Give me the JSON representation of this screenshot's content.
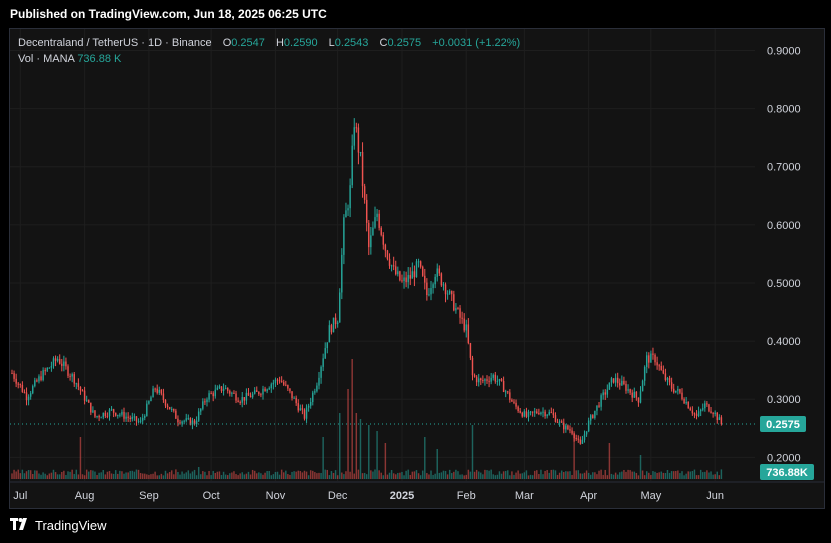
{
  "header": {
    "published": "Published on TradingView.com, Jun 18, 2025 06:25 UTC"
  },
  "legend": {
    "symbol": "Decentraland / TetherUS · 1D · Binance",
    "o_label": "O",
    "o_value": "0.2547",
    "h_label": "H",
    "h_value": "0.2590",
    "l_label": "L",
    "l_value": "0.2543",
    "c_label": "C",
    "c_value": "0.2575",
    "change": "+0.0031 (+1.22%)",
    "vol_label": "Vol · MANA",
    "vol_value": "736.88 K"
  },
  "footer": {
    "brand": "TradingView"
  },
  "colors": {
    "up": "#26a69a",
    "down": "#ef5350",
    "price_badge": "#26a69a",
    "background": "#131313"
  },
  "chart_data": {
    "type": "candlestick",
    "y_ticks": [
      "0.9000",
      "0.8000",
      "0.7000",
      "0.6000",
      "0.5000",
      "0.4000",
      "0.3000",
      "0.2000"
    ],
    "ylim": [
      0.18,
      0.93
    ],
    "x_labels": [
      "Jul",
      "Aug",
      "Sep",
      "Oct",
      "Nov",
      "Dec",
      "2025",
      "Feb",
      "Mar",
      "Apr",
      "May",
      "Jun"
    ],
    "last_price": "0.2575",
    "last_volume": "736.88K",
    "series": [
      {
        "name": "price",
        "anchors": [
          {
            "d": 0,
            "v": 0.345
          },
          {
            "d": 7,
            "v": 0.305
          },
          {
            "d": 14,
            "v": 0.34
          },
          {
            "d": 22,
            "v": 0.37
          },
          {
            "d": 30,
            "v": 0.335
          },
          {
            "d": 40,
            "v": 0.27
          },
          {
            "d": 48,
            "v": 0.28
          },
          {
            "d": 55,
            "v": 0.27
          },
          {
            "d": 62,
            "v": 0.26
          },
          {
            "d": 69,
            "v": 0.32
          },
          {
            "d": 80,
            "v": 0.265
          },
          {
            "d": 88,
            "v": 0.26
          },
          {
            "d": 94,
            "v": 0.305
          },
          {
            "d": 102,
            "v": 0.32
          },
          {
            "d": 110,
            "v": 0.3
          },
          {
            "d": 118,
            "v": 0.31
          },
          {
            "d": 124,
            "v": 0.325
          },
          {
            "d": 129,
            "v": 0.335
          },
          {
            "d": 135,
            "v": 0.305
          },
          {
            "d": 141,
            "v": 0.27
          },
          {
            "d": 147,
            "v": 0.33
          },
          {
            "d": 153,
            "v": 0.42
          },
          {
            "d": 157,
            "v": 0.44
          },
          {
            "d": 160,
            "v": 0.6
          },
          {
            "d": 163,
            "v": 0.66
          },
          {
            "d": 165,
            "v": 0.78
          },
          {
            "d": 168,
            "v": 0.71
          },
          {
            "d": 172,
            "v": 0.56
          },
          {
            "d": 176,
            "v": 0.62
          },
          {
            "d": 180,
            "v": 0.56
          },
          {
            "d": 184,
            "v": 0.52
          },
          {
            "d": 188,
            "v": 0.5
          },
          {
            "d": 192,
            "v": 0.51
          },
          {
            "d": 196,
            "v": 0.53
          },
          {
            "d": 200,
            "v": 0.48
          },
          {
            "d": 204,
            "v": 0.52
          },
          {
            "d": 208,
            "v": 0.5
          },
          {
            "d": 212,
            "v": 0.47
          },
          {
            "d": 216,
            "v": 0.44
          },
          {
            "d": 219,
            "v": 0.42
          },
          {
            "d": 222,
            "v": 0.34
          },
          {
            "d": 226,
            "v": 0.33
          },
          {
            "d": 232,
            "v": 0.34
          },
          {
            "d": 237,
            "v": 0.32
          },
          {
            "d": 242,
            "v": 0.29
          },
          {
            "d": 248,
            "v": 0.27
          },
          {
            "d": 254,
            "v": 0.28
          },
          {
            "d": 260,
            "v": 0.275
          },
          {
            "d": 265,
            "v": 0.255
          },
          {
            "d": 270,
            "v": 0.245
          },
          {
            "d": 274,
            "v": 0.22
          },
          {
            "d": 278,
            "v": 0.26
          },
          {
            "d": 284,
            "v": 0.3
          },
          {
            "d": 290,
            "v": 0.335
          },
          {
            "d": 296,
            "v": 0.32
          },
          {
            "d": 302,
            "v": 0.3
          },
          {
            "d": 306,
            "v": 0.37
          },
          {
            "d": 310,
            "v": 0.37
          },
          {
            "d": 314,
            "v": 0.34
          },
          {
            "d": 318,
            "v": 0.32
          },
          {
            "d": 322,
            "v": 0.31
          },
          {
            "d": 326,
            "v": 0.29
          },
          {
            "d": 330,
            "v": 0.27
          },
          {
            "d": 334,
            "v": 0.29
          },
          {
            "d": 338,
            "v": 0.28
          },
          {
            "d": 342,
            "v": 0.258
          }
        ]
      },
      {
        "name": "volume",
        "spikes": [
          {
            "d": 33,
            "v": 0.35
          },
          {
            "d": 90,
            "v": 0.1
          },
          {
            "d": 150,
            "v": 0.35
          },
          {
            "d": 158,
            "v": 0.55
          },
          {
            "d": 162,
            "v": 0.75
          },
          {
            "d": 164,
            "v": 1.0
          },
          {
            "d": 166,
            "v": 0.55
          },
          {
            "d": 168,
            "v": 0.5
          },
          {
            "d": 172,
            "v": 0.45
          },
          {
            "d": 176,
            "v": 0.4
          },
          {
            "d": 180,
            "v": 0.3
          },
          {
            "d": 199,
            "v": 0.35
          },
          {
            "d": 205,
            "v": 0.25
          },
          {
            "d": 222,
            "v": 0.45
          },
          {
            "d": 271,
            "v": 0.4
          },
          {
            "d": 288,
            "v": 0.3
          },
          {
            "d": 303,
            "v": 0.2
          }
        ]
      }
    ]
  }
}
